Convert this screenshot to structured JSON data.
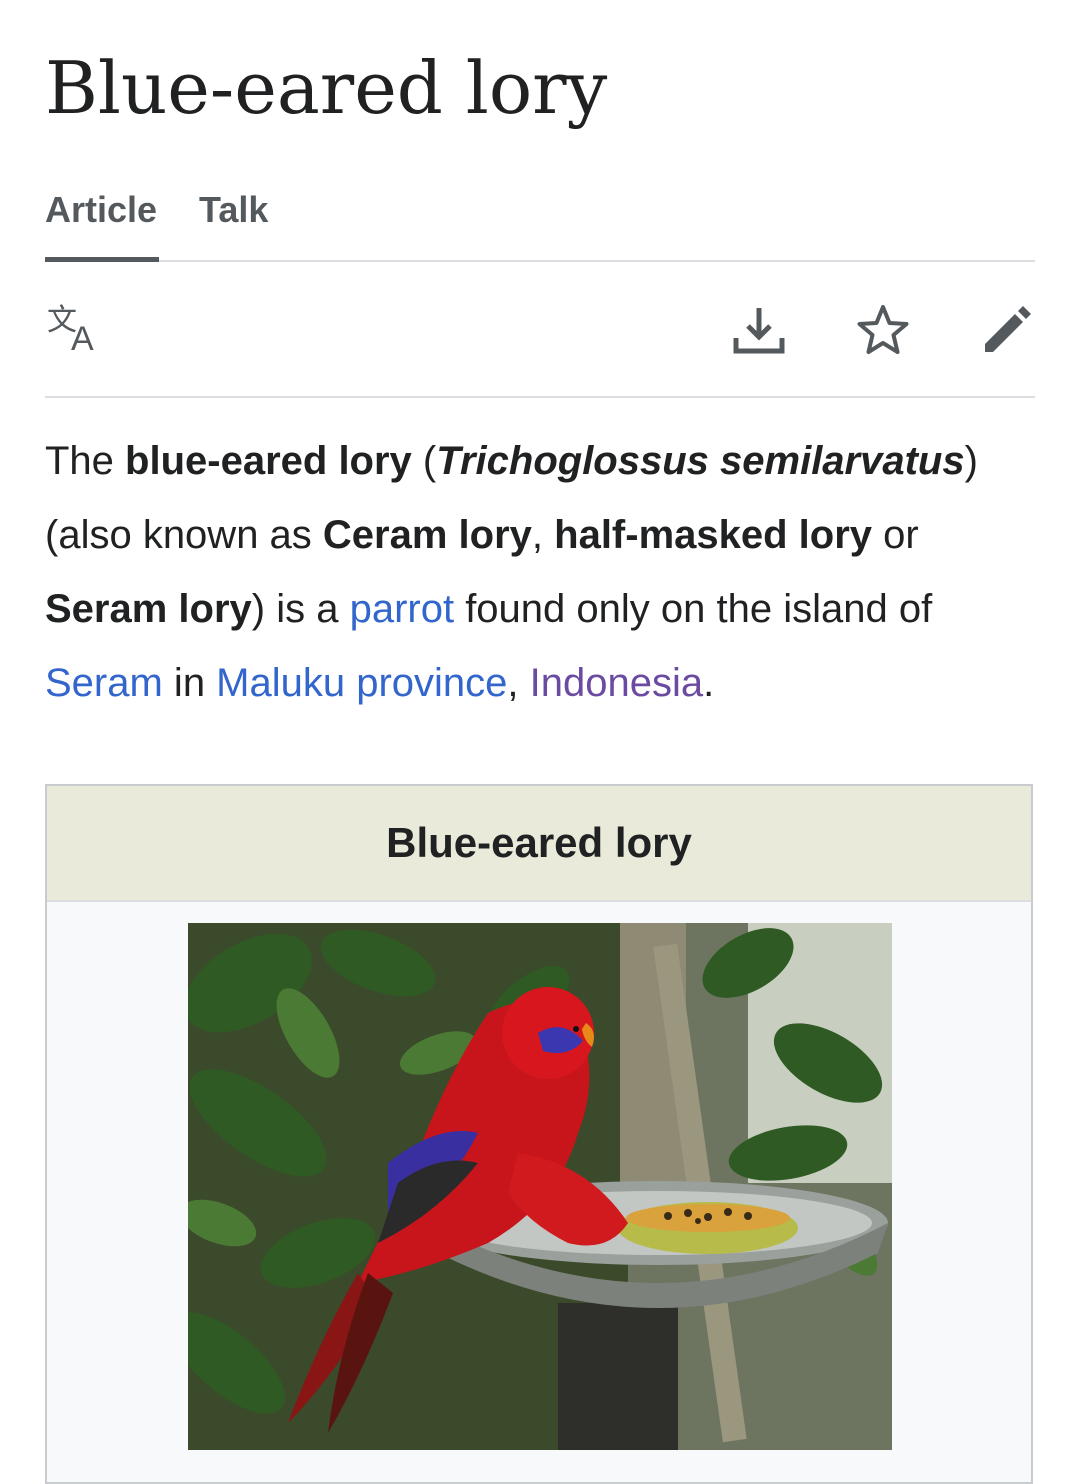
{
  "page": {
    "title": "Blue-eared lory"
  },
  "tabs": {
    "article": "Article",
    "talk": "Talk"
  },
  "toolbar": {
    "icons": [
      "language-icon",
      "download-icon",
      "star-icon",
      "edit-pencil-icon"
    ]
  },
  "lead": {
    "t1": "The ",
    "b1": "blue-eared lory",
    "t2": " (",
    "i1": "Trichoglossus semilarvatus",
    "t3": ") (also known as ",
    "b2": "Ceram lory",
    "t4": ", ",
    "b3": "half-masked lory",
    "t5": " or ",
    "b4": "Seram lory",
    "t6": ") is a ",
    "l1": "parrot",
    "t7": " found only on the island of ",
    "l2": "Seram",
    "t8": " in ",
    "l3": "Maluku province",
    "t9": ", ",
    "l4": "Indonesia",
    "t10": "."
  },
  "infobox": {
    "title": "Blue-eared lory"
  },
  "colors": {
    "text": "#202122",
    "link": "#3366cc",
    "visited_link": "#6b4ba1",
    "infobox_header_bg": "#eaeadb",
    "divider": "#dadde1"
  }
}
